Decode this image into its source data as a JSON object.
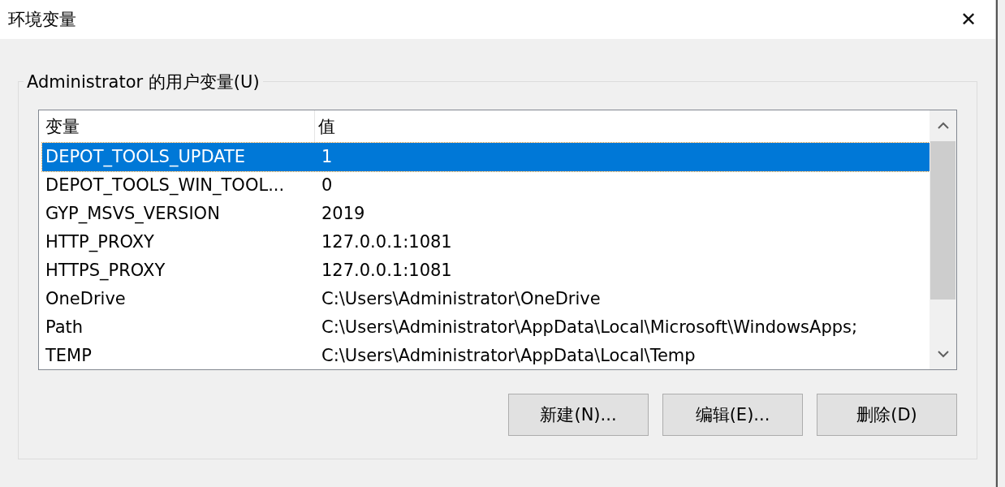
{
  "window": {
    "title": "环境变量",
    "close": "✕"
  },
  "group": {
    "title": "Administrator 的用户变量(U)"
  },
  "table": {
    "columns": [
      "变量",
      "值"
    ],
    "rows": [
      {
        "name": "DEPOT_TOOLS_UPDATE",
        "value": "1",
        "selected": true
      },
      {
        "name": "DEPOT_TOOLS_WIN_TOOL...",
        "value": "0",
        "selected": false
      },
      {
        "name": "GYP_MSVS_VERSION",
        "value": "2019",
        "selected": false
      },
      {
        "name": "HTTP_PROXY",
        "value": "127.0.0.1:1081",
        "selected": false
      },
      {
        "name": "HTTPS_PROXY",
        "value": "127.0.0.1:1081",
        "selected": false
      },
      {
        "name": "OneDrive",
        "value": "C:\\Users\\Administrator\\OneDrive",
        "selected": false
      },
      {
        "name": "Path",
        "value": "C:\\Users\\Administrator\\AppData\\Local\\Microsoft\\WindowsApps;",
        "selected": false
      },
      {
        "name": "TEMP",
        "value": "C:\\Users\\Administrator\\AppData\\Local\\Temp",
        "selected": false
      }
    ]
  },
  "buttons": [
    "新建(N)...",
    "编辑(E)...",
    "删除(D)"
  ]
}
